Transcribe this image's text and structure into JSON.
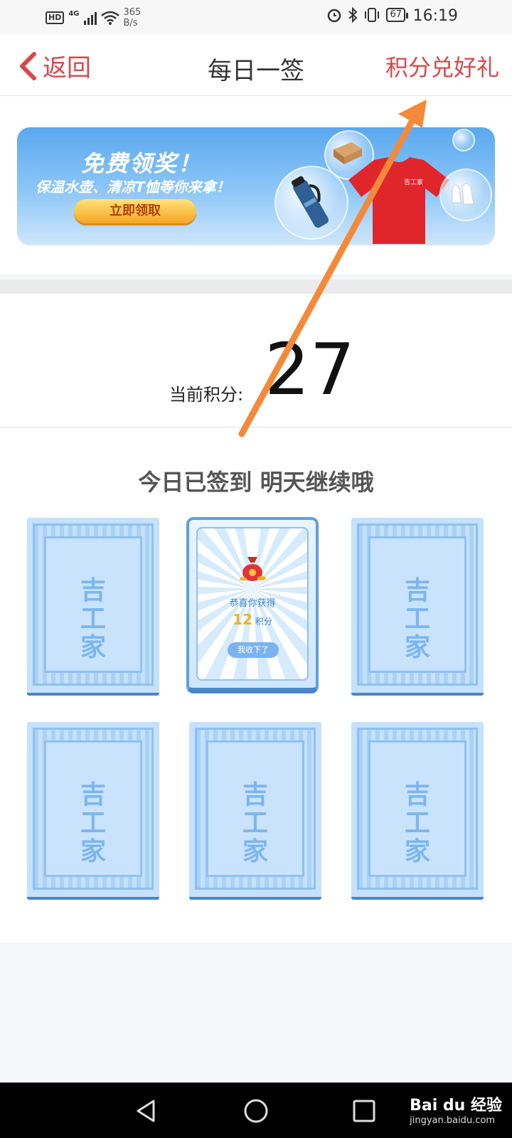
{
  "status_bar": {
    "hd": "HD",
    "network": "4G",
    "speed_value": "365",
    "speed_unit": "B/s",
    "battery": "67",
    "time": "16:19"
  },
  "header": {
    "back_label": "返回",
    "title": "每日一签",
    "exchange_label": "积分兑好礼"
  },
  "banner": {
    "headline": "免费领奖！",
    "subline": "保温水壶、清凉T恤等你来拿！",
    "cta": "立即领取",
    "shirt_logo": "吉工家"
  },
  "points": {
    "label": "当前积分:",
    "value": "27"
  },
  "sign_status": "今日已签到 明天继续哦",
  "cards": [
    {
      "state": "closed",
      "brand": "吉工家"
    },
    {
      "state": "opened",
      "congrats": "恭喜你获得",
      "amount": "12",
      "unit": "积分",
      "button": "我收下了"
    },
    {
      "state": "closed",
      "brand": "吉工家"
    },
    {
      "state": "closed",
      "brand": "吉工家"
    },
    {
      "state": "closed",
      "brand": "吉工家"
    },
    {
      "state": "closed",
      "brand": "吉工家"
    }
  ],
  "nav": {
    "back_icon": "triangle-back-icon",
    "home_icon": "circle-home-icon",
    "recent_icon": "square-recent-icon"
  },
  "watermark": {
    "brand": "Bai du 经验",
    "url": "jingyan.baidu.com"
  },
  "colors": {
    "accent": "#d9474a",
    "arrow": "#f5893a",
    "card_blue": "#c5e1fb"
  }
}
